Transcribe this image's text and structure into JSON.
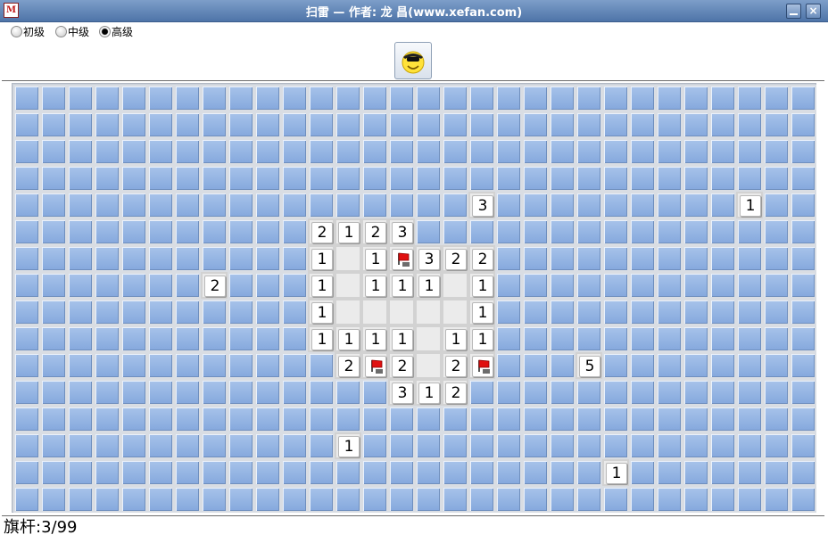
{
  "window": {
    "title": "扫雷 — 作者: 龙 昌(www.xefan.com)",
    "icon": "minesweeper-app-icon",
    "icon_glyph": "M"
  },
  "levels": [
    {
      "label": "初级",
      "selected": false
    },
    {
      "label": "中级",
      "selected": false
    },
    {
      "label": "高级",
      "selected": true
    }
  ],
  "face_button": {
    "icon": "smiley-face-icon"
  },
  "board": {
    "cols": 30,
    "rows": 16,
    "revealed_numbers": [
      {
        "row": 4,
        "col": 17,
        "value": "3"
      },
      {
        "row": 4,
        "col": 27,
        "value": "1"
      },
      {
        "row": 5,
        "col": 11,
        "value": "2"
      },
      {
        "row": 5,
        "col": 12,
        "value": "1"
      },
      {
        "row": 5,
        "col": 13,
        "value": "2"
      },
      {
        "row": 5,
        "col": 14,
        "value": "3"
      },
      {
        "row": 6,
        "col": 11,
        "value": "1"
      },
      {
        "row": 6,
        "col": 13,
        "value": "1"
      },
      {
        "row": 6,
        "col": 15,
        "value": "3"
      },
      {
        "row": 6,
        "col": 16,
        "value": "2"
      },
      {
        "row": 6,
        "col": 17,
        "value": "2"
      },
      {
        "row": 7,
        "col": 7,
        "value": "2"
      },
      {
        "row": 7,
        "col": 11,
        "value": "1"
      },
      {
        "row": 7,
        "col": 13,
        "value": "1"
      },
      {
        "row": 7,
        "col": 14,
        "value": "1"
      },
      {
        "row": 7,
        "col": 15,
        "value": "1"
      },
      {
        "row": 7,
        "col": 17,
        "value": "1"
      },
      {
        "row": 8,
        "col": 11,
        "value": "1"
      },
      {
        "row": 8,
        "col": 17,
        "value": "1"
      },
      {
        "row": 9,
        "col": 11,
        "value": "1"
      },
      {
        "row": 9,
        "col": 12,
        "value": "1"
      },
      {
        "row": 9,
        "col": 13,
        "value": "1"
      },
      {
        "row": 9,
        "col": 14,
        "value": "1"
      },
      {
        "row": 9,
        "col": 16,
        "value": "1"
      },
      {
        "row": 9,
        "col": 17,
        "value": "1"
      },
      {
        "row": 10,
        "col": 12,
        "value": "2"
      },
      {
        "row": 10,
        "col": 14,
        "value": "2"
      },
      {
        "row": 10,
        "col": 16,
        "value": "2"
      },
      {
        "row": 10,
        "col": 21,
        "value": "5"
      },
      {
        "row": 11,
        "col": 14,
        "value": "3"
      },
      {
        "row": 11,
        "col": 15,
        "value": "1"
      },
      {
        "row": 11,
        "col": 16,
        "value": "2"
      },
      {
        "row": 13,
        "col": 12,
        "value": "1"
      },
      {
        "row": 14,
        "col": 22,
        "value": "1"
      }
    ],
    "revealed_empty": [
      {
        "row": 6,
        "col": 12
      },
      {
        "row": 7,
        "col": 12
      },
      {
        "row": 7,
        "col": 16
      },
      {
        "row": 8,
        "col": 12
      },
      {
        "row": 8,
        "col": 13
      },
      {
        "row": 8,
        "col": 14
      },
      {
        "row": 8,
        "col": 15
      },
      {
        "row": 8,
        "col": 16
      },
      {
        "row": 9,
        "col": 15
      },
      {
        "row": 10,
        "col": 15
      }
    ],
    "flags": [
      {
        "row": 6,
        "col": 14,
        "icon": "red-flag-icon"
      },
      {
        "row": 10,
        "col": 13,
        "icon": "red-flag-icon"
      },
      {
        "row": 10,
        "col": 17,
        "icon": "red-flag-icon"
      }
    ]
  },
  "status": {
    "text": "旗杆:3/99"
  }
}
